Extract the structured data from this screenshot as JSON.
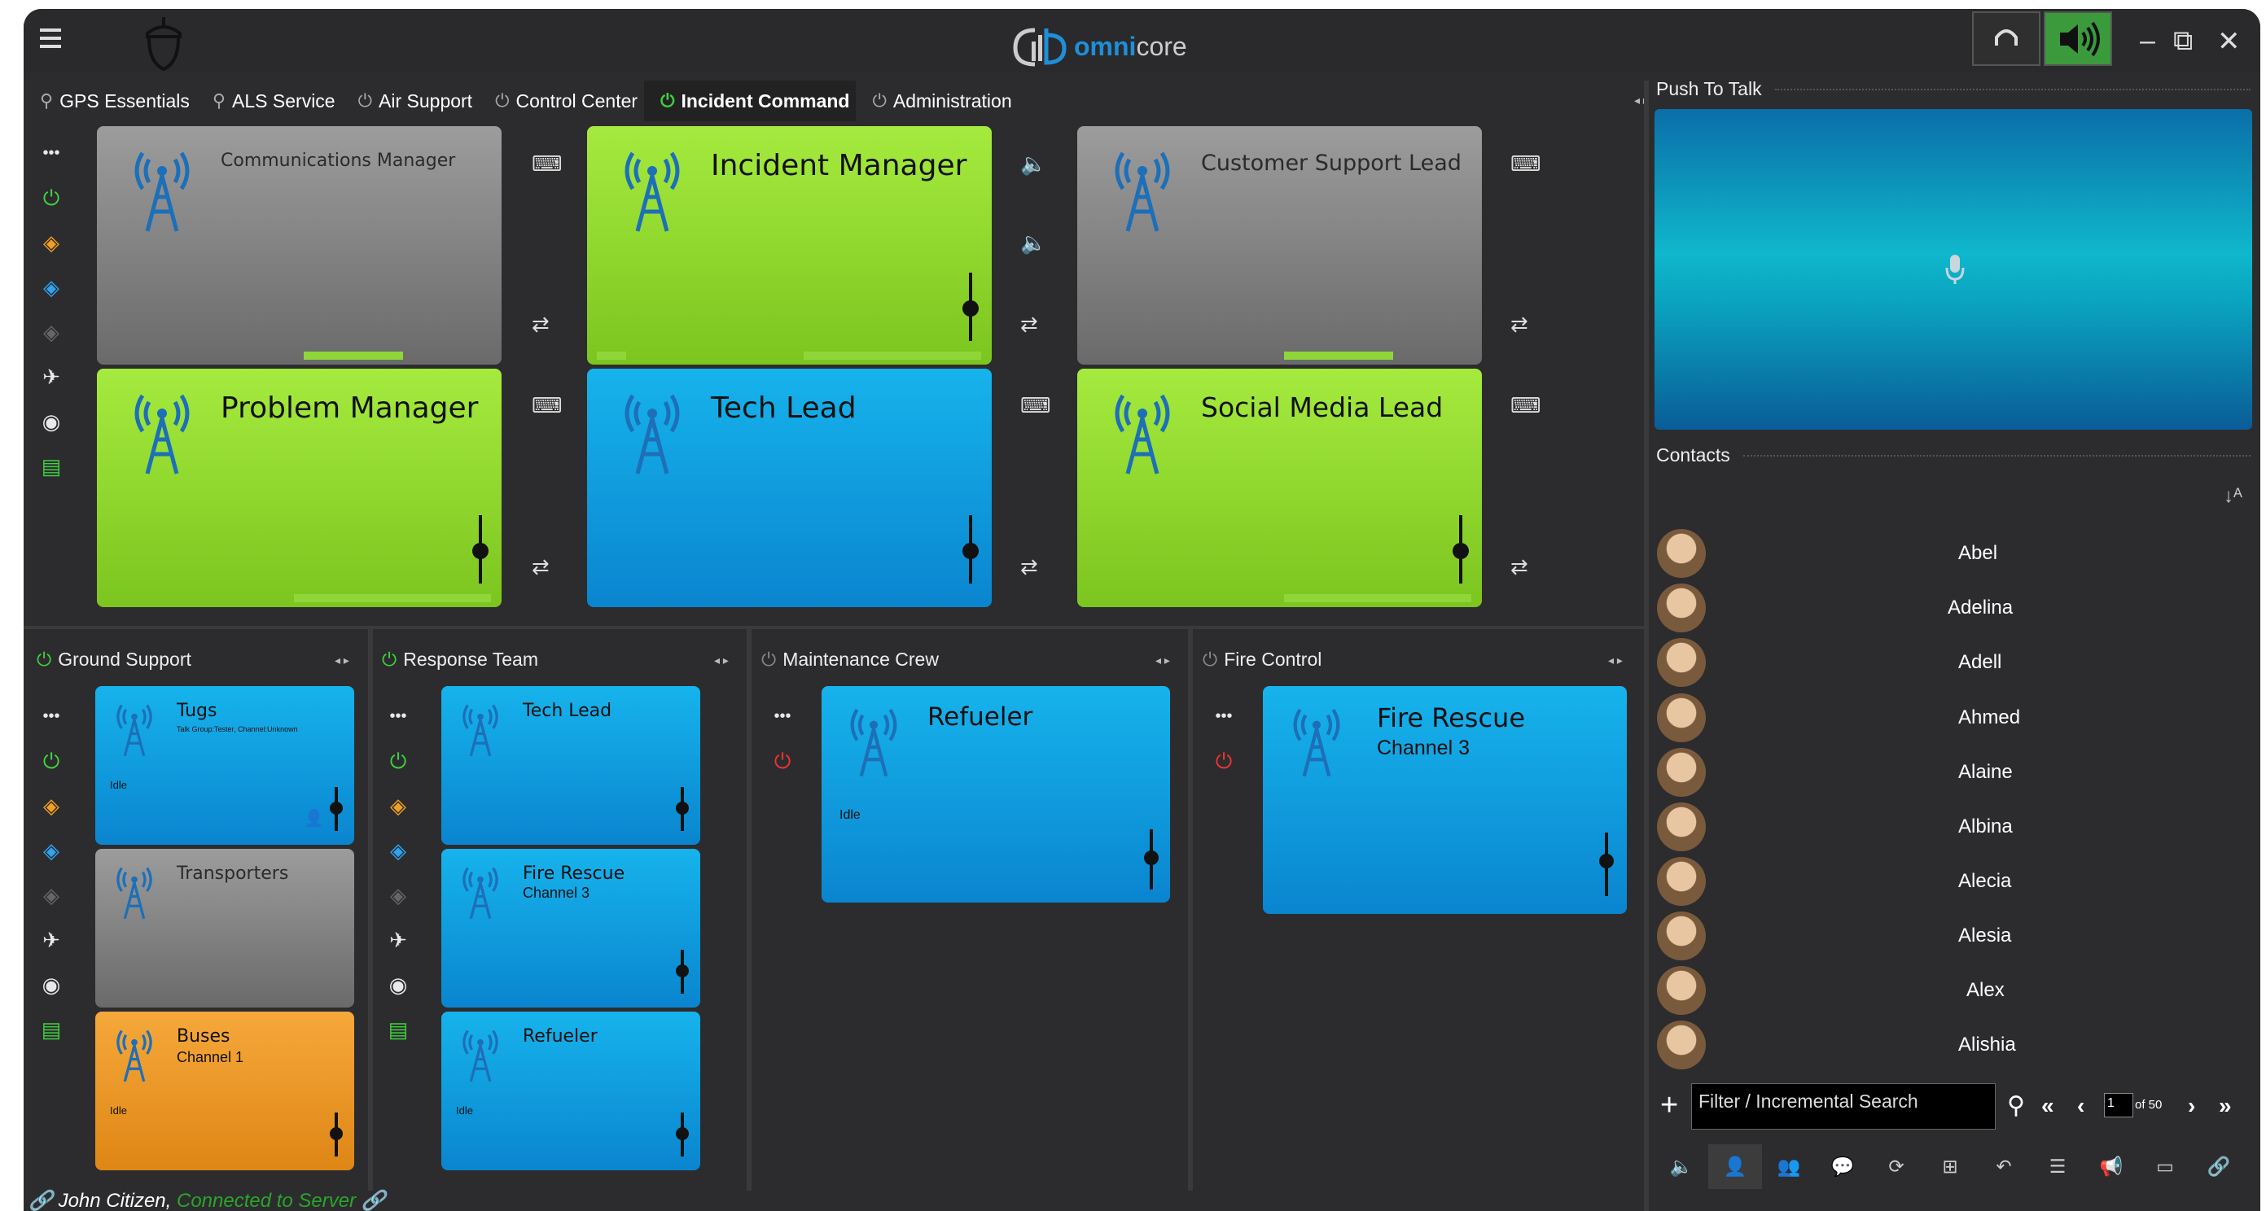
{
  "app": {
    "brand_prefix": "omni",
    "brand_suffix": "core",
    "accent": "#1e8fd8",
    "active_green": "#3fd13f"
  },
  "tabs": [
    {
      "label": "GPS Essentials",
      "icon": "map-pin-icon"
    },
    {
      "label": "ALS Service",
      "icon": "map-pin-icon"
    },
    {
      "label": "Air Support",
      "icon": "power-icon"
    },
    {
      "label": "Control Center",
      "icon": "power-icon"
    },
    {
      "label": "Incident Command",
      "icon": "power-icon",
      "active": true
    },
    {
      "label": "Administration",
      "icon": "power-icon"
    }
  ],
  "main_tiles": [
    {
      "name": "Communications Manager",
      "color": "gray"
    },
    {
      "name": "Incident Manager",
      "color": "green"
    },
    {
      "name": "Customer Support Lead",
      "color": "gray"
    },
    {
      "name": "Problem Manager",
      "color": "green"
    },
    {
      "name": "Tech Lead",
      "color": "blue"
    },
    {
      "name": "Social Media Lead",
      "color": "green"
    }
  ],
  "panels": [
    {
      "title": "Ground Support",
      "active": true,
      "tiles": [
        {
          "name": "Tugs",
          "sub": "Talk Group:Tester, Channel:Unknown",
          "status": "Idle",
          "color": "blue"
        },
        {
          "name": "Transporters",
          "sub": "",
          "status": "",
          "color": "gray"
        },
        {
          "name": "Buses",
          "sub": "Channel 1",
          "status": "Idle",
          "color": "orange"
        }
      ]
    },
    {
      "title": "Response Team",
      "active": true,
      "tiles": [
        {
          "name": "Tech Lead",
          "sub": "",
          "status": "",
          "color": "blue"
        },
        {
          "name": "Fire Rescue",
          "sub": "Channel 3",
          "status": "",
          "color": "blue"
        },
        {
          "name": "Refueler",
          "sub": "",
          "status": "Idle",
          "color": "blue"
        }
      ]
    },
    {
      "title": "Maintenance Crew",
      "active": false,
      "tiles": [
        {
          "name": "Refueler",
          "sub": "",
          "status": "Idle",
          "color": "blue"
        }
      ]
    },
    {
      "title": "Fire Control",
      "active": false,
      "tiles": [
        {
          "name": "Fire Rescue",
          "sub": "Channel 3",
          "status": "",
          "color": "blue"
        }
      ]
    }
  ],
  "push_to_talk": {
    "title": "Push To Talk"
  },
  "contacts": {
    "title": "Contacts",
    "items": [
      "Abel",
      "Adelina",
      "Adell",
      "Ahmed",
      "Alaine",
      "Albina",
      "Alecia",
      "Alesia",
      "Alex",
      "Alishia"
    ],
    "search_placeholder": "Filter / Incremental Search",
    "page": "1",
    "page_total": "of 50"
  },
  "status": {
    "user": "John Citizen,",
    "connection": "Connected to Server"
  }
}
